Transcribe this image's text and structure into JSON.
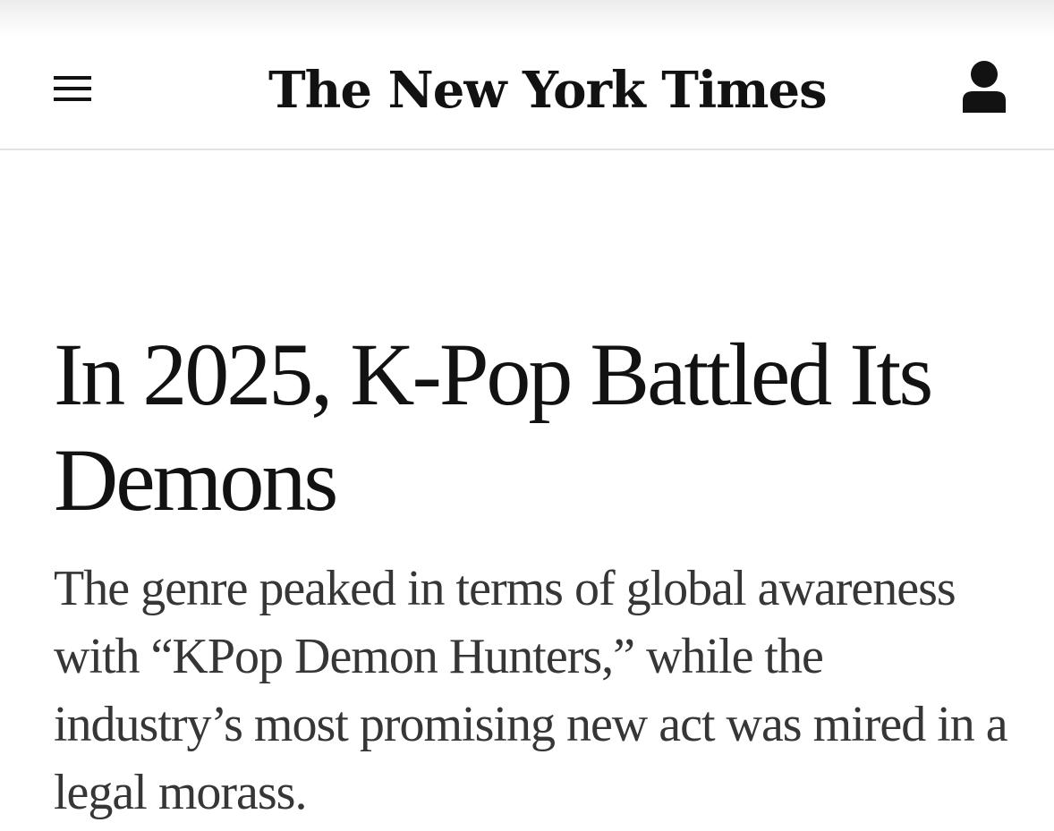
{
  "header": {
    "masthead": "The New York Times",
    "menu_icon": "hamburger-menu-icon",
    "account_icon": "user-account-icon"
  },
  "article": {
    "headline": "In 2025, K-Pop Battled Its Demons",
    "summary": "The genre peaked in terms of global awareness with “KPop Demon Hunters,” while the industry’s most promising new act was mired in a legal morass."
  }
}
